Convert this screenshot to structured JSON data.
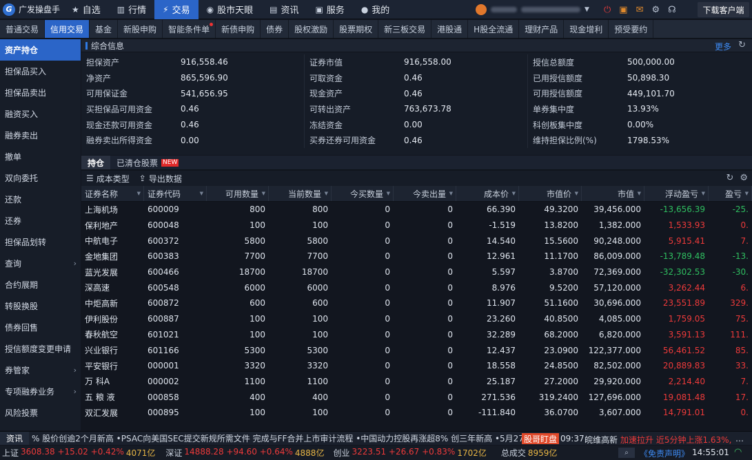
{
  "app": {
    "name": "广发操盘手",
    "download": "下载客户端"
  },
  "topnav": [
    {
      "label": "自选",
      "icon": "star-icon",
      "glyph": "★"
    },
    {
      "label": "行情",
      "icon": "chart-icon",
      "glyph": "▥"
    },
    {
      "label": "交易",
      "icon": "trade-icon",
      "glyph": "⚡",
      "active": true
    },
    {
      "label": "股市天眼",
      "icon": "eye-icon",
      "glyph": "◉"
    },
    {
      "label": "资讯",
      "icon": "news-icon",
      "glyph": "▤"
    },
    {
      "label": "服务",
      "icon": "briefcase-icon",
      "glyph": "▣"
    },
    {
      "label": "我的",
      "icon": "user-icon",
      "glyph": "●"
    }
  ],
  "tabs": [
    {
      "label": "普通交易"
    },
    {
      "label": "信用交易",
      "active": true
    },
    {
      "label": "基金"
    },
    {
      "label": "新股申购"
    },
    {
      "label": "智能条件单",
      "dot": true
    },
    {
      "label": "新债申购"
    },
    {
      "label": "债券"
    },
    {
      "label": "股权激励"
    },
    {
      "label": "股票期权"
    },
    {
      "label": "新三板交易"
    },
    {
      "label": "港股通"
    },
    {
      "label": "H股全流通"
    },
    {
      "label": "理财产品"
    },
    {
      "label": "现金增利"
    },
    {
      "label": "预受要约"
    }
  ],
  "sidebar": [
    {
      "label": "资产持仓",
      "active": true
    },
    {
      "label": "担保品买入"
    },
    {
      "label": "担保品卖出"
    },
    {
      "label": "融资买入"
    },
    {
      "label": "融券卖出"
    },
    {
      "label": "撤单"
    },
    {
      "label": "双向委托"
    },
    {
      "label": "还款"
    },
    {
      "label": "还券"
    },
    {
      "label": "担保品划转"
    },
    {
      "label": "查询",
      "chev": true
    },
    {
      "label": "合约展期"
    },
    {
      "label": "转股换股"
    },
    {
      "label": "债券回售"
    },
    {
      "label": "授信额度变更申请"
    },
    {
      "label": "券管家",
      "chev": true
    },
    {
      "label": "专项融券业务",
      "chev": true
    },
    {
      "label": "风险投票"
    }
  ],
  "info": {
    "title": "综合信息",
    "more": "更多",
    "cols": [
      [
        {
          "k": "担保资产",
          "v": "916,558.46"
        },
        {
          "k": "净资产",
          "v": "865,596.90"
        },
        {
          "k": "可用保证金",
          "v": "541,656.95"
        },
        {
          "k": "买担保品可用资金",
          "v": "0.46"
        },
        {
          "k": "现金还款可用资金",
          "v": "0.46"
        },
        {
          "k": "融券卖出所得资金",
          "v": "0.00"
        }
      ],
      [
        {
          "k": "证券市值",
          "v": "916,558.00"
        },
        {
          "k": "可取资金",
          "v": "0.46"
        },
        {
          "k": "现金资产",
          "v": "0.46"
        },
        {
          "k": "可转出资产",
          "v": "763,673.78"
        },
        {
          "k": "冻结资金",
          "v": "0.00"
        },
        {
          "k": "买券还券可用资金",
          "v": "0.46"
        }
      ],
      [
        {
          "k": "授信总额度",
          "v": "500,000.00"
        },
        {
          "k": "已用授信额度",
          "v": "50,898.30"
        },
        {
          "k": "可用授信额度",
          "v": "449,101.70"
        },
        {
          "k": "单券集中度",
          "v": "13.93%"
        },
        {
          "k": "科创板集中度",
          "v": "0.00%"
        },
        {
          "k": "维持担保比例(%)",
          "v": "1798.53%"
        }
      ]
    ]
  },
  "holdtabs": {
    "hold": "持仓",
    "cleared": "已清仓股票",
    "new": "NEW"
  },
  "toolbar": {
    "cost_type": "成本类型",
    "export": "导出数据"
  },
  "table": {
    "headers": [
      "证券名称",
      "证券代码",
      "可用数量",
      "当前数量",
      "今买数量",
      "今卖出量",
      "成本价",
      "市值价",
      "市值",
      "浮动盈亏",
      "盈亏"
    ],
    "rows": [
      [
        "上海机场",
        "600009",
        "800",
        "800",
        "0",
        "0",
        "66.390",
        "49.3200",
        "39,456.000",
        "-13,656.39",
        "-25."
      ],
      [
        "保利地产",
        "600048",
        "100",
        "100",
        "0",
        "0",
        "-1.519",
        "13.8200",
        "1,382.000",
        "1,533.93",
        "0."
      ],
      [
        "中航电子",
        "600372",
        "5800",
        "5800",
        "0",
        "0",
        "14.540",
        "15.5600",
        "90,248.000",
        "5,915.41",
        "7."
      ],
      [
        "金地集团",
        "600383",
        "7700",
        "7700",
        "0",
        "0",
        "12.961",
        "11.1700",
        "86,009.000",
        "-13,789.48",
        "-13."
      ],
      [
        "蓝光发展",
        "600466",
        "18700",
        "18700",
        "0",
        "0",
        "5.597",
        "3.8700",
        "72,369.000",
        "-32,302.53",
        "-30."
      ],
      [
        "深高速",
        "600548",
        "6000",
        "6000",
        "0",
        "0",
        "8.976",
        "9.5200",
        "57,120.000",
        "3,262.44",
        "6."
      ],
      [
        "中炬高新",
        "600872",
        "600",
        "600",
        "0",
        "0",
        "11.907",
        "51.1600",
        "30,696.000",
        "23,551.89",
        "329."
      ],
      [
        "伊利股份",
        "600887",
        "100",
        "100",
        "0",
        "0",
        "23.260",
        "40.8500",
        "4,085.000",
        "1,759.05",
        "75."
      ],
      [
        "春秋航空",
        "601021",
        "100",
        "100",
        "0",
        "0",
        "32.289",
        "68.2000",
        "6,820.000",
        "3,591.13",
        "111."
      ],
      [
        "兴业银行",
        "601166",
        "5300",
        "5300",
        "0",
        "0",
        "12.437",
        "23.0900",
        "122,377.000",
        "56,461.52",
        "85."
      ],
      [
        "平安银行",
        "000001",
        "3320",
        "3320",
        "0",
        "0",
        "18.558",
        "24.8500",
        "82,502.000",
        "20,889.83",
        "33."
      ],
      [
        "万 科A",
        "000002",
        "1100",
        "1100",
        "0",
        "0",
        "25.187",
        "27.2000",
        "29,920.000",
        "2,214.40",
        "7."
      ],
      [
        "五 粮 液",
        "000858",
        "400",
        "400",
        "0",
        "0",
        "271.536",
        "319.2400",
        "127,696.000",
        "19,081.48",
        "17."
      ],
      [
        "双汇发展",
        "000895",
        "100",
        "100",
        "0",
        "0",
        "-111.840",
        "36.0700",
        "3,607.000",
        "14,791.01",
        "0."
      ]
    ]
  },
  "ticker": {
    "label": "资讯",
    "text": "% 股价创逾2个月新高   •PSAC向美国SEC提交新规所需文件 完成与FF合并上市审计流程   •中国动力控股再涨超8% 创三年新高   •5月27",
    "badge": "股哥盯盘",
    "time": "09:37",
    "stock": "皖维高新",
    "speed": "加速拉升  近5分钟上涨1.63%,"
  },
  "status": {
    "sh": {
      "name": "上证",
      "val": "3608.38 +15.02 +0.42%",
      "amt": "4071亿"
    },
    "sz": {
      "name": "深证",
      "val": "14888.28 +94.60 +0.64%",
      "amt": "4888亿"
    },
    "cy": {
      "name": "创业",
      "val": "3223.51 +26.67 +0.83%",
      "amt": "1702亿"
    },
    "total": {
      "name": "总成交",
      "amt": "8959亿"
    },
    "disclaimer": "《免责声明》",
    "clock": "14:55:01"
  }
}
